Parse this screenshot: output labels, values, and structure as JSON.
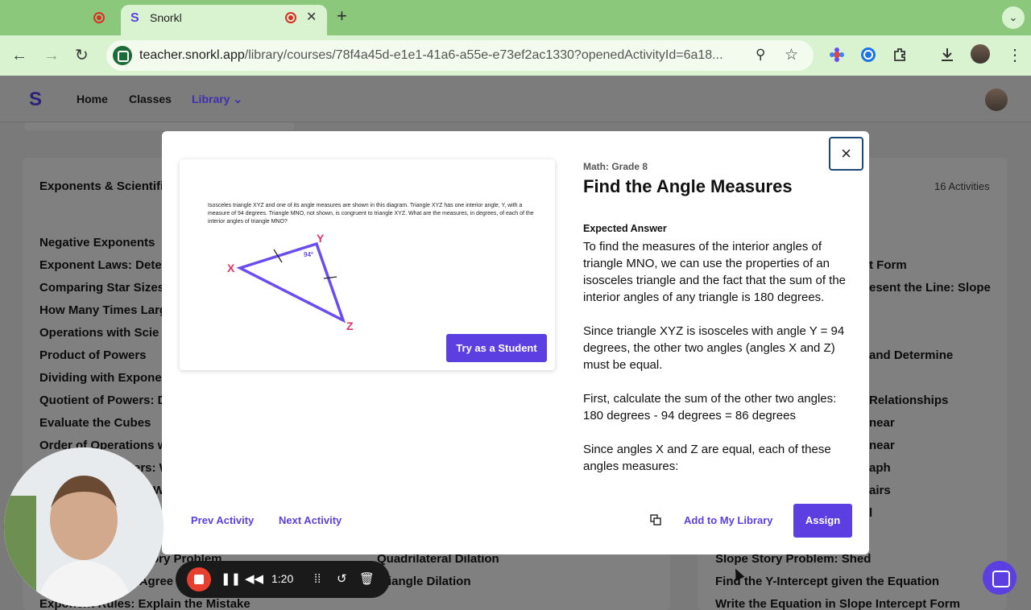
{
  "browser": {
    "tab_title": "Snorkl",
    "tab_logo": "S",
    "url_host": "teacher.snorkl.app",
    "url_path": "/library/courses/78f4a45d-e1e1-41a6-a55e-e73ef2ac1330?openedActivityId=6a18..."
  },
  "app": {
    "logo": "S",
    "nav": [
      "Home",
      "Classes",
      "Library"
    ]
  },
  "background": {
    "section_title": "Exponents & Scientific",
    "activity_count": "16 Activities",
    "left_items": [
      "Negative Exponents",
      "Exponent Laws: Deter",
      "Comparing Star Sizes",
      "How Many Times Larg",
      "Operations with Scie",
      "Product of Powers",
      "Dividing with Exponen",
      "Quotient of Powers: D",
      "Evaluate the Cubes",
      "Order of Operations w",
      "ers: W",
      "W",
      "",
      "ory Problem",
      ": Agree",
      "Exponent Rules: Explain the Mistake"
    ],
    "middle_items": [
      "Quadrilateral Dilation",
      "iangle Dilation"
    ],
    "right_items": [
      "t Form",
      "esent the Line: Slope",
      "and Determine",
      "Relationships",
      "near",
      "near",
      "aph",
      "airs",
      "l",
      "Slope Story Problem: Shed",
      "Find the Y-Intercept given the Equation",
      "Write the Equation in Slope Intercept Form"
    ]
  },
  "modal": {
    "grade": "Math: Grade 8",
    "title": "Find the Angle Measures",
    "preview_prompt": "Isosceles triangle XYZ and one of its angle measures are shown in this diagram. Triangle XYZ has one interior angle, Y, with a measure of 94 degrees. Triangle MNO, not shown, is congruent to triangle XYZ. What are the measures, in degrees, of each of the interior angles of triangle MNO?",
    "diagram": {
      "x_label": "X",
      "y_label": "Y",
      "z_label": "Z",
      "angle_label": "94°"
    },
    "try_button": "Try as a Student",
    "expected_label": "Expected Answer",
    "answer_paragraphs": [
      "To find the measures of the interior angles of triangle MNO, we can use the properties of an isosceles triangle and the fact that the sum of the interior angles of any triangle is 180 degrees.",
      "Since triangle XYZ is isosceles with angle Y = 94 degrees, the other two angles (angles X and Z) must be equal.",
      "First, calculate the sum of the other two angles: 180 degrees - 94 degrees = 86 degrees",
      "Since angles X and Z are equal, each of these angles measures:"
    ],
    "prev_label": "Prev Activity",
    "next_label": "Next Activity",
    "add_label": "Add to My Library",
    "assign_label": "Assign",
    "close_icon": "×"
  },
  "recorder": {
    "time": "1:20"
  },
  "colors": {
    "brand": "#5b3fe0",
    "tabbar": "#8cc87c",
    "toolbar": "#d9f2cf"
  }
}
